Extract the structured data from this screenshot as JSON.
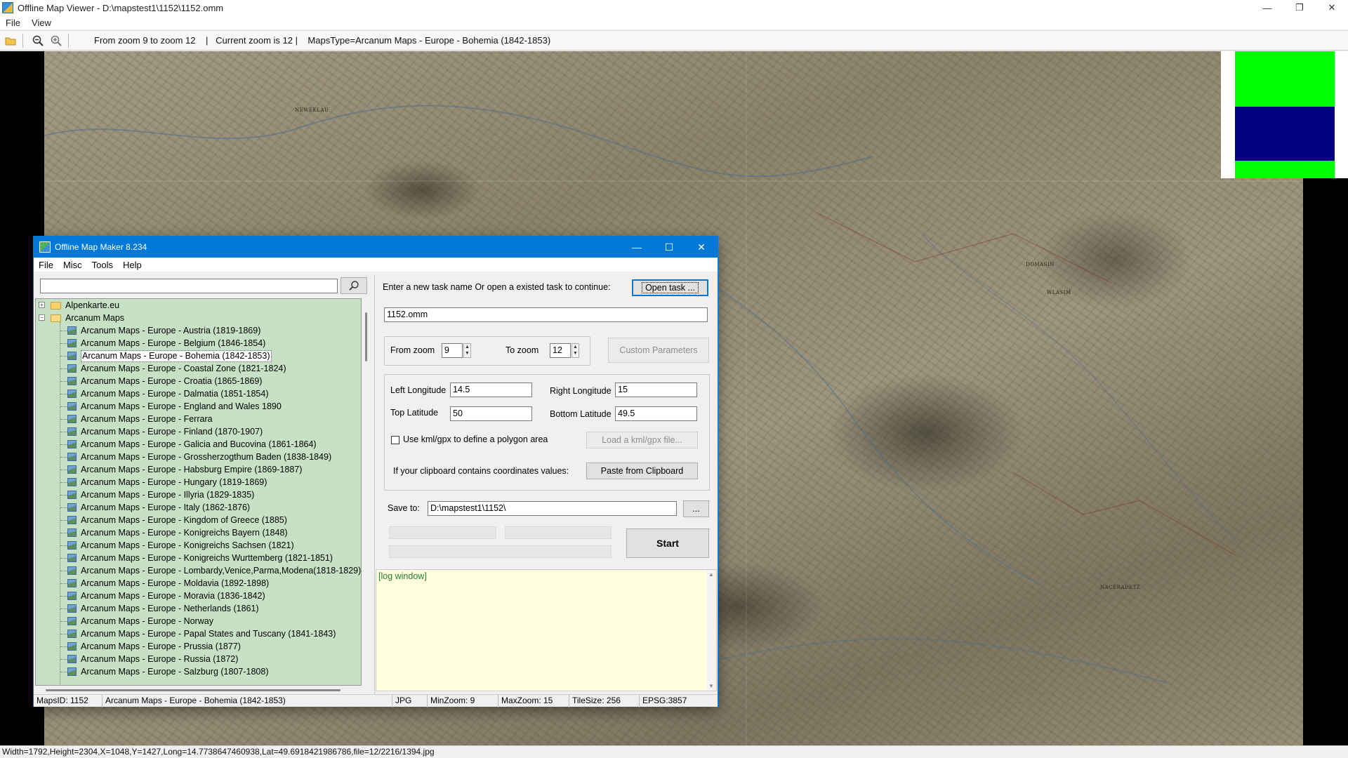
{
  "window": {
    "title": "Offline Map Viewer - D:\\mapstest1\\1152\\1152.omm",
    "menu": [
      "File",
      "View"
    ]
  },
  "toolbar": {
    "info": "From zoom 9 to zoom 12    |   Current zoom is 12 |    MapsType=Arcanum Maps - Europe - Bohemia (1842-1853)"
  },
  "map": {
    "labels": [
      "NEWEKLAU",
      "DOMASIN",
      "WLASIM",
      "NACERADETZ"
    ]
  },
  "statusbar": {
    "text": "Width=1792,Height=2304,X=1048,Y=1427,Long=14.7738647460938,Lat=49.6918421986786,file=12/2216/1394.jpg"
  },
  "dialog": {
    "title": "Offline Map Maker 8.234",
    "menu": [
      "File",
      "Misc",
      "Tools",
      "Help"
    ],
    "search": {
      "value": ""
    },
    "tree": {
      "roots": [
        {
          "label": "Alpenkarte.eu",
          "expanded": false
        },
        {
          "label": "Arcanum Maps",
          "expanded": true
        }
      ],
      "children": [
        "Arcanum Maps - Europe - Austria (1819-1869)",
        "Arcanum Maps - Europe - Belgium (1846-1854)",
        "Arcanum Maps - Europe - Bohemia (1842-1853)",
        "Arcanum Maps - Europe - Coastal Zone (1821-1824)",
        "Arcanum Maps - Europe - Croatia (1865-1869)",
        "Arcanum Maps - Europe - Dalmatia (1851-1854)",
        "Arcanum Maps - Europe - England and Wales 1890",
        "Arcanum Maps - Europe - Ferrara",
        "Arcanum Maps - Europe - Finland (1870-1907)",
        "Arcanum Maps - Europe - Galicia and Bucovina (1861-1864)",
        "Arcanum Maps - Europe - Grossherzogthum Baden (1838-1849)",
        "Arcanum Maps - Europe - Habsburg Empire (1869-1887)",
        "Arcanum Maps - Europe - Hungary (1819-1869)",
        "Arcanum Maps - Europe - Illyria (1829-1835)",
        "Arcanum Maps - Europe - Italy (1862-1876)",
        "Arcanum Maps - Europe - Kingdom of Greece (1885)",
        "Arcanum Maps - Europe - Konigreichs Bayern (1848)",
        "Arcanum Maps - Europe - Konigreichs Sachsen (1821)",
        "Arcanum Maps - Europe - Konigreichs Wurttemberg (1821-1851)",
        "Arcanum Maps - Europe - Lombardy,Venice,Parma,Modena(1818-1829)",
        "Arcanum Maps - Europe - Moldavia (1892-1898)",
        "Arcanum Maps - Europe - Moravia (1836-1842)",
        "Arcanum Maps - Europe - Netherlands (1861)",
        "Arcanum Maps - Europe - Norway",
        "Arcanum Maps - Europe - Papal States and Tuscany (1841-1843)",
        "Arcanum Maps - Europe - Prussia (1877)",
        "Arcanum Maps - Europe - Russia (1872)",
        "Arcanum Maps - Europe - Salzburg (1807-1808)"
      ],
      "selected_index": 2
    },
    "task": {
      "prompt": "Enter a new task name Or open a existed task to continue:",
      "open_button": "Open task ...",
      "name": "1152.omm"
    },
    "zoom": {
      "from_label": "From zoom",
      "from_value": "9",
      "to_label": "To zoom",
      "to_value": "12",
      "custom_button": "Custom Parameters"
    },
    "coords": {
      "left_lon_label": "Left Longitude",
      "left_lon": "14.5",
      "right_lon_label": "Right Longitude",
      "right_lon": "15",
      "top_lat_label": "Top Latitude",
      "top_lat": "50",
      "bottom_lat_label": "Bottom Latitude",
      "bottom_lat": "49.5",
      "kml_checkbox": "Use kml/gpx to define a polygon area",
      "kml_button": "Load a kml/gpx file...",
      "clipboard_label": "If your clipboard contains coordinates values:",
      "clipboard_button": "Paste from Clipboard"
    },
    "save": {
      "label": "Save to:",
      "path": "D:\\mapstest1\\1152\\",
      "browse": "..."
    },
    "start_button": "Start",
    "log": "[log window]",
    "status": {
      "maps_id": "MapsID: 1152",
      "map_name": "Arcanum Maps - Europe - Bohemia (1842-1853)",
      "format": "JPG",
      "min_zoom": "MinZoom: 9",
      "max_zoom": "MaxZoom: 15",
      "tile_size": "TileSize: 256",
      "epsg": "EPSG:3857"
    }
  },
  "colors": {
    "accent": "#0078d7",
    "tree_bg": "#c7e1c5",
    "log_bg": "#ffffe0",
    "minimap_green": "#00ff00",
    "minimap_blue": "#000080"
  }
}
